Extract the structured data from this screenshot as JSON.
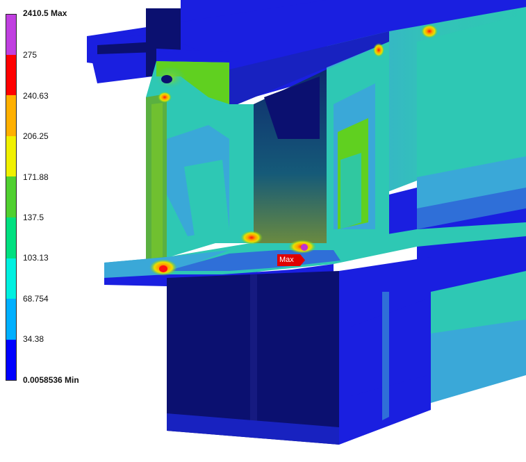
{
  "legend": {
    "max_label": "2410.5 Max",
    "min_label": "0.0058536 Min",
    "levels": [
      "275",
      "240.63",
      "206.25",
      "171.88",
      "137.5",
      "103.13",
      "68.754",
      "34.38"
    ],
    "band_colors": [
      "#c040e0",
      "#ff0000",
      "#ffb000",
      "#f0f000",
      "#50d030",
      "#00e080",
      "#00f0e0",
      "#00b0ff",
      "#0000ff"
    ]
  },
  "probe": {
    "label": "Max"
  },
  "colors": {
    "dark_navy": "#0b1070",
    "blue": "#1a1fe0",
    "mid_blue": "#2f6fd8",
    "light_blue": "#3aa8e0",
    "teal": "#30c8b0",
    "green": "#60d020",
    "yellow": "#e8e000",
    "orange": "#ffa000",
    "red": "#ff1010",
    "magenta": "#c030d0"
  }
}
